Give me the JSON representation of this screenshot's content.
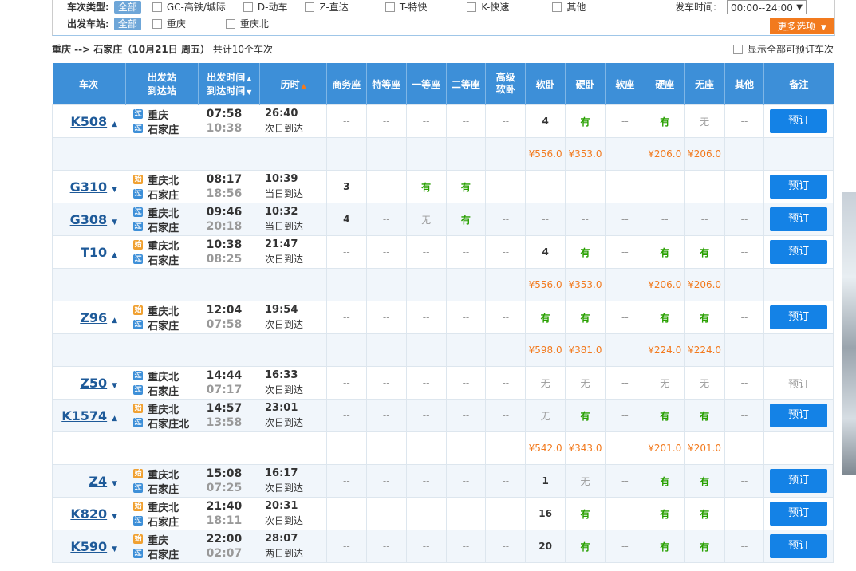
{
  "filter": {
    "type_label": "车次类型:",
    "station_label": "出发车站:",
    "all_label": "全部",
    "types": [
      "GC-高铁/城际",
      "D-动车",
      "Z-直达",
      "T-特快",
      "K-快速",
      "其他"
    ],
    "stations": [
      "重庆",
      "重庆北"
    ],
    "time_label": "发车时间:",
    "time_value": "00:00--24:00",
    "more_label": "更多选项"
  },
  "summary": {
    "route": "重庆 --> 石家庄（10月21日  周五）",
    "count": "共计10个车次",
    "show_all": "显示全部可预订车次"
  },
  "headers": {
    "train": "车次",
    "station1": "出发站",
    "station2": "到达站",
    "time1": "出发时间",
    "time2": "到达时间",
    "duration": "历时",
    "seats": [
      "商务座",
      "特等座",
      "一等座",
      "二等座",
      "高级软卧",
      "软卧",
      "硬卧",
      "软座",
      "硬座",
      "无座",
      "其他"
    ],
    "note": "备注"
  },
  "rows": [
    {
      "no": "K508",
      "from": "重庆",
      "from_badge": "过",
      "to": "石家庄",
      "to_badge": "过",
      "dep": "07:58",
      "arr": "10:38",
      "dur": "26:40",
      "arrive": "次日到达",
      "seats": [
        "--",
        "--",
        "--",
        "--",
        "--",
        "4",
        "有",
        "--",
        "有",
        "无",
        "--"
      ],
      "book": "预订",
      "bookable": true,
      "prices": [
        "",
        "",
        "",
        "",
        "",
        "¥556.0",
        "¥353.0",
        "",
        "¥206.0",
        "¥206.0",
        ""
      ]
    },
    {
      "no": "G310",
      "from": "重庆北",
      "from_badge": "始",
      "to": "石家庄",
      "to_badge": "过",
      "dep": "08:17",
      "arr": "18:56",
      "dur": "10:39",
      "arrive": "当日到达",
      "seats": [
        "3",
        "--",
        "有",
        "有",
        "--",
        "--",
        "--",
        "--",
        "--",
        "--",
        "--"
      ],
      "book": "预订",
      "bookable": true,
      "prices": null
    },
    {
      "no": "G308",
      "from": "重庆北",
      "from_badge": "过",
      "to": "石家庄",
      "to_badge": "过",
      "dep": "09:46",
      "arr": "20:18",
      "dur": "10:32",
      "arrive": "当日到达",
      "seats": [
        "4",
        "--",
        "无",
        "有",
        "--",
        "--",
        "--",
        "--",
        "--",
        "--",
        "--"
      ],
      "book": "预订",
      "bookable": true,
      "prices": null
    },
    {
      "no": "T10",
      "from": "重庆北",
      "from_badge": "始",
      "to": "石家庄",
      "to_badge": "过",
      "dep": "10:38",
      "arr": "08:25",
      "dur": "21:47",
      "arrive": "次日到达",
      "seats": [
        "--",
        "--",
        "--",
        "--",
        "--",
        "4",
        "有",
        "--",
        "有",
        "有",
        "--"
      ],
      "book": "预订",
      "bookable": true,
      "prices": [
        "",
        "",
        "",
        "",
        "",
        "¥556.0",
        "¥353.0",
        "",
        "¥206.0",
        "¥206.0",
        ""
      ]
    },
    {
      "no": "Z96",
      "from": "重庆北",
      "from_badge": "始",
      "to": "石家庄",
      "to_badge": "过",
      "dep": "12:04",
      "arr": "07:58",
      "dur": "19:54",
      "arrive": "次日到达",
      "seats": [
        "--",
        "--",
        "--",
        "--",
        "--",
        "有",
        "有",
        "--",
        "有",
        "有",
        "--"
      ],
      "book": "预订",
      "bookable": true,
      "prices": [
        "",
        "",
        "",
        "",
        "",
        "¥598.0",
        "¥381.0",
        "",
        "¥224.0",
        "¥224.0",
        ""
      ]
    },
    {
      "no": "Z50",
      "from": "重庆北",
      "from_badge": "过",
      "to": "石家庄",
      "to_badge": "过",
      "dep": "14:44",
      "arr": "07:17",
      "dur": "16:33",
      "arrive": "次日到达",
      "seats": [
        "--",
        "--",
        "--",
        "--",
        "--",
        "无",
        "无",
        "--",
        "无",
        "无",
        "--"
      ],
      "book": "预订",
      "bookable": false,
      "prices": null
    },
    {
      "no": "K1574",
      "from": "重庆北",
      "from_badge": "始",
      "to": "石家庄北",
      "to_badge": "过",
      "dep": "14:57",
      "arr": "13:58",
      "dur": "23:01",
      "arrive": "次日到达",
      "seats": [
        "--",
        "--",
        "--",
        "--",
        "--",
        "无",
        "有",
        "--",
        "有",
        "有",
        "--"
      ],
      "book": "预订",
      "bookable": true,
      "prices": [
        "",
        "",
        "",
        "",
        "",
        "¥542.0",
        "¥343.0",
        "",
        "¥201.0",
        "¥201.0",
        ""
      ]
    },
    {
      "no": "Z4",
      "from": "重庆北",
      "from_badge": "始",
      "to": "石家庄",
      "to_badge": "过",
      "dep": "15:08",
      "arr": "07:25",
      "dur": "16:17",
      "arrive": "次日到达",
      "seats": [
        "--",
        "--",
        "--",
        "--",
        "--",
        "1",
        "无",
        "--",
        "有",
        "有",
        "--"
      ],
      "book": "预订",
      "bookable": true,
      "prices": null
    },
    {
      "no": "K820",
      "from": "重庆北",
      "from_badge": "始",
      "to": "石家庄",
      "to_badge": "过",
      "dep": "21:40",
      "arr": "18:11",
      "dur": "20:31",
      "arrive": "次日到达",
      "seats": [
        "--",
        "--",
        "--",
        "--",
        "--",
        "16",
        "有",
        "--",
        "有",
        "有",
        "--"
      ],
      "book": "预订",
      "bookable": true,
      "prices": null
    },
    {
      "no": "K590",
      "from": "重庆",
      "from_badge": "始",
      "to": "石家庄",
      "to_badge": "过",
      "dep": "22:00",
      "arr": "02:07",
      "dur": "28:07",
      "arrive": "两日到达",
      "seats": [
        "--",
        "--",
        "--",
        "--",
        "--",
        "20",
        "有",
        "--",
        "有",
        "有",
        "--"
      ],
      "book": "预订",
      "bookable": true,
      "prices": null
    }
  ]
}
